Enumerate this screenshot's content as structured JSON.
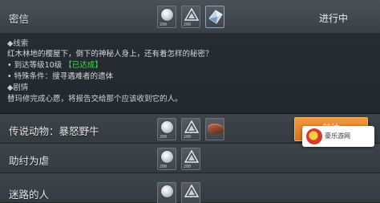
{
  "header": {
    "title": "密信",
    "status": "进行中"
  },
  "rewards_header": [
    {
      "icon": "silver-coin-icon",
      "qty": "200"
    },
    {
      "icon": "experience-icon",
      "qty": "200"
    },
    {
      "icon": "gem-item-icon",
      "qty": ""
    }
  ],
  "detail": {
    "clue_heading": "◆线索",
    "clue_text": "红木林地的樱屋下，倒下的神秘人身上，还有着怎样的秘密？",
    "req_level_prefix": "• 到达等级10级",
    "req_level_done": "【已达成】",
    "req_special": "• 特殊条件：搜寻遇难者的遗体",
    "plot_heading": "◆剧情",
    "plot_text": "替玛修完成心愿，将报告交给那个应该收到它的人。"
  },
  "quests": [
    {
      "title": "传说动物：暴怒野牛",
      "rewards": [
        {
          "icon": "silver-coin-icon",
          "qty": "200"
        },
        {
          "icon": "experience-icon",
          "qty": "200"
        },
        {
          "icon": "meat-item-icon",
          "qty": ""
        }
      ],
      "action": "前往"
    },
    {
      "title": "助纣为虐",
      "rewards": [
        {
          "icon": "silver-coin-icon",
          "qty": "200"
        },
        {
          "icon": "experience-icon",
          "qty": "200"
        }
      ]
    },
    {
      "title": "迷路的人",
      "rewards": [
        {
          "icon": "silver-coin-icon",
          "qty": ""
        },
        {
          "icon": "experience-icon",
          "qty": ""
        }
      ]
    }
  ],
  "watermark": {
    "text": "豪乐游网"
  },
  "colors": {
    "accent": "#e8862c",
    "done": "#3ddc4a"
  }
}
